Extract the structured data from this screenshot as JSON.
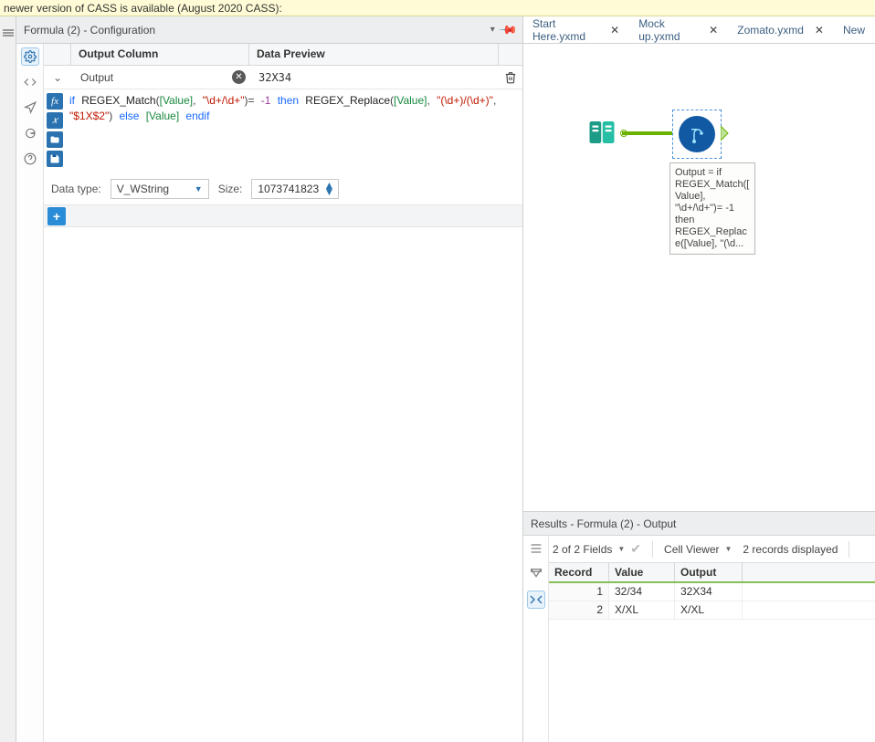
{
  "banner": {
    "text": "newer version of CASS is available (August 2020 CASS):"
  },
  "config": {
    "title": "Formula (2) - Configuration",
    "columns": {
      "output": "Output Column",
      "preview": "Data Preview"
    },
    "row": {
      "output_name": "Output",
      "preview": "32X34"
    },
    "formula_plain": "if REGEX_Match([Value], \"\\d+/\\d+\")= -1 then REGEX_Replace([Value], \"(\\d+)/(\\d+)\", \"$1X$2\") else [Value] endif",
    "datatype_label": "Data type:",
    "datatype_value": "V_WString",
    "size_label": "Size:",
    "size_value": "1073741823"
  },
  "tabs": [
    {
      "label": "Start Here.yxmd",
      "closable": true
    },
    {
      "label": "Mock up.yxmd",
      "closable": true
    },
    {
      "label": "Zomato.yxmd",
      "closable": true
    },
    {
      "label": "New",
      "closable": false
    }
  ],
  "canvas": {
    "annotation": "Output = if REGEX_Match([Value], \"\\d+/\\d+\")= -1 then REGEX_Replace([Value], \"(\\d..."
  },
  "results": {
    "title": "Results - Formula (2) - Output",
    "fields_text": "2 of 2 Fields",
    "cellviewer": "Cell Viewer",
    "records_text": "2 records displayed",
    "columns": {
      "record": "Record",
      "value": "Value",
      "output": "Output"
    },
    "rows": [
      {
        "record": "1",
        "value": "32/34",
        "output": "32X34"
      },
      {
        "record": "2",
        "value": "X/XL",
        "output": "X/XL"
      }
    ]
  }
}
